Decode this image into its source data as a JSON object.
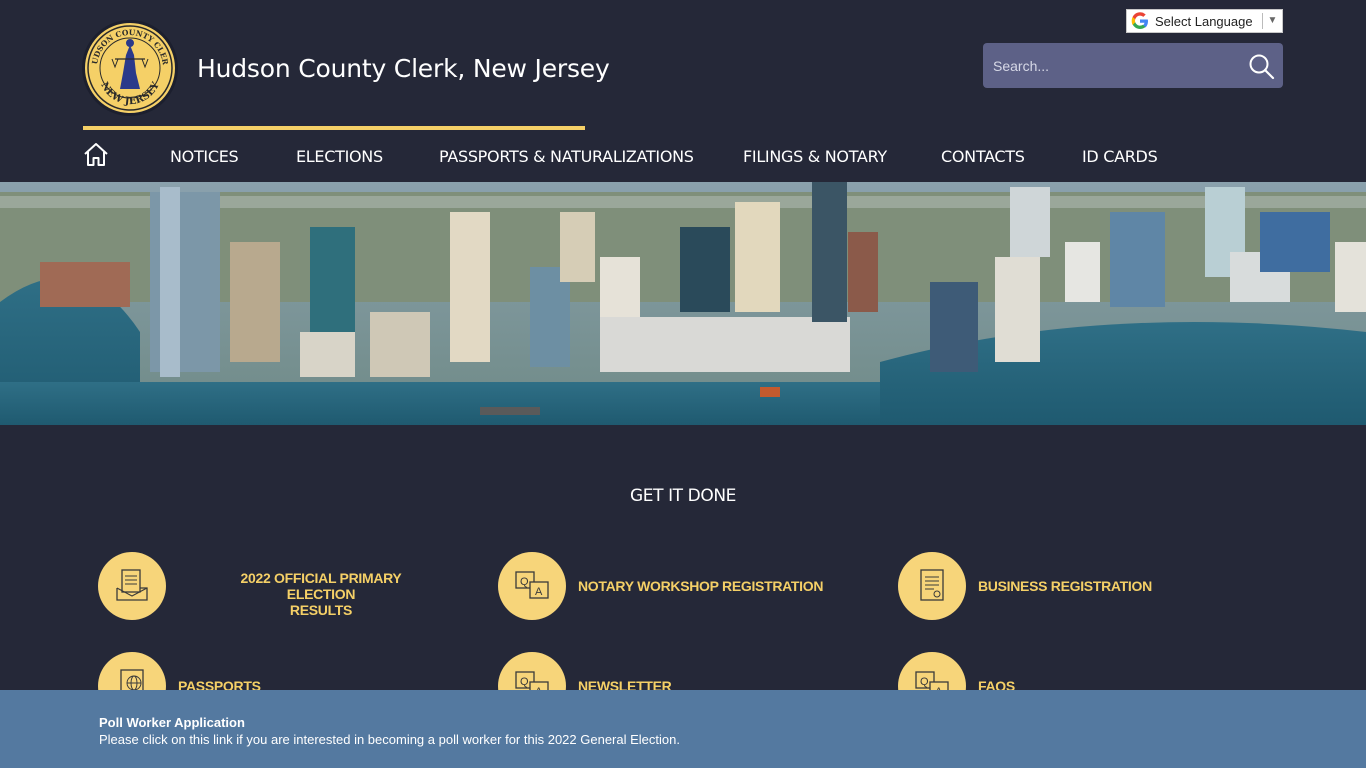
{
  "header": {
    "site_title": "Hudson County Clerk, New Jersey",
    "logo_top_text": "HUDSON COUNTY CLERK",
    "logo_bottom_text": "NEW JERSEY",
    "language_label": "Select Language",
    "search_placeholder": "Search..."
  },
  "nav": {
    "items": [
      {
        "label": "NOTICES"
      },
      {
        "label": "ELECTIONS"
      },
      {
        "label": "PASSPORTS & NATURALIZATIONS"
      },
      {
        "label": "FILINGS & NOTARY"
      },
      {
        "label": "CONTACTS"
      },
      {
        "label": "ID CARDS"
      }
    ]
  },
  "section": {
    "title": "GET IT DONE",
    "tiles": [
      {
        "line1": "2022 OFFICIAL PRIMARY ELECTION",
        "line2": "RESULTS",
        "icon": "ballot-icon"
      },
      {
        "line1": "NOTARY WORKSHOP REGISTRATION",
        "icon": "qa-icon"
      },
      {
        "line1": "BUSINESS REGISTRATION",
        "icon": "certificate-icon"
      },
      {
        "line1": "PASSPORTS",
        "icon": "passport-icon"
      },
      {
        "line1": "NEWSLETTER",
        "icon": "qa-icon"
      },
      {
        "line1": "FAQS",
        "icon": "qa-icon"
      }
    ]
  },
  "banner": {
    "title": "Poll Worker Application",
    "text": "Please click on this link if you are interested in becoming a poll worker for this 2022 General Election."
  },
  "colors": {
    "background": "#252838",
    "accent": "#f5d067",
    "search_bg": "#5d6187",
    "banner_bg": "#5479a0"
  }
}
